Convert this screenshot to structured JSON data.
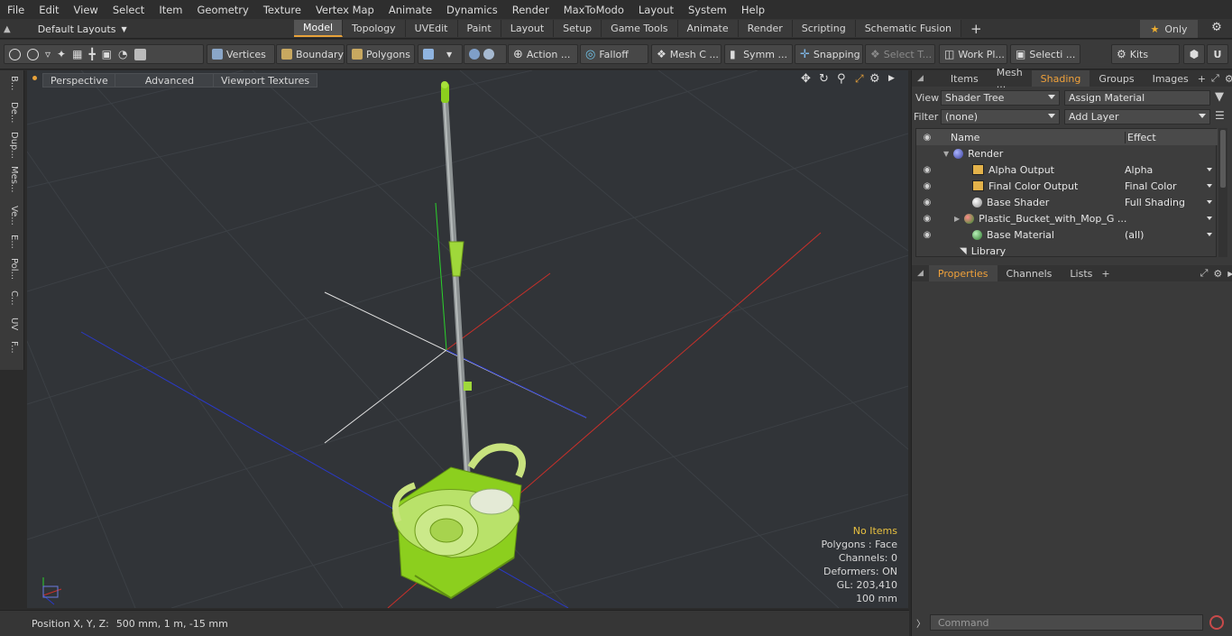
{
  "menu": [
    "File",
    "Edit",
    "View",
    "Select",
    "Item",
    "Geometry",
    "Texture",
    "Vertex Map",
    "Animate",
    "Dynamics",
    "Render",
    "MaxToModo",
    "Layout",
    "System",
    "Help"
  ],
  "layout_selector": "Default Layouts",
  "tabs": [
    "Model",
    "Topology",
    "UVEdit",
    "Paint",
    "Layout",
    "Setup",
    "Game Tools",
    "Animate",
    "Render",
    "Scripting",
    "Schematic Fusion"
  ],
  "active_tab": "Model",
  "only_label": "Only",
  "toolbar": {
    "vertices": "Vertices",
    "boundary": "Boundary",
    "polygons": "Polygons",
    "action": "Action ...",
    "falloff": "Falloff",
    "mesh": "Mesh C ...",
    "symm": "Symm ...",
    "snapping": "Snapping",
    "select_t": "Select T...",
    "workplane": "Work Pl...",
    "selecti": "Selecti ...",
    "kits": "Kits"
  },
  "left_tabs": [
    "B...",
    "De...",
    "Dup...",
    "Mes...",
    "Ve...",
    "E...",
    "Pol...",
    "C...",
    "UV",
    "F..."
  ],
  "viewport": {
    "perspective": "Perspective",
    "advanced": "Advanced",
    "viewport_textures": "Viewport Textures",
    "stats": {
      "items": "No Items",
      "polygons": "Polygons : Face",
      "channels": "Channels: 0",
      "deformers": "Deformers: ON",
      "gl": "GL: 203,410",
      "scale": "100 mm"
    }
  },
  "status": {
    "label": "Position X, Y, Z:",
    "value": "500 mm, 1 m, -15 mm"
  },
  "right_panel": {
    "tabs": [
      "Items",
      "Mesh ...",
      "Shading",
      "Groups",
      "Images"
    ],
    "active_tab": "Shading",
    "view_label": "View",
    "view_value": "Shader Tree",
    "assign_material": "Assign Material",
    "filter_label": "Filter",
    "filter_value": "(none)",
    "add_layer": "Add Layer",
    "columns": {
      "name": "Name",
      "effect": "Effect"
    },
    "rows": [
      {
        "name": "Render",
        "effect": ""
      },
      {
        "name": "Alpha Output",
        "effect": "Alpha"
      },
      {
        "name": "Final Color Output",
        "effect": "Final Color"
      },
      {
        "name": "Base Shader",
        "effect": "Full Shading"
      },
      {
        "name": "Plastic_Bucket_with_Mop_G ...",
        "effect": ""
      },
      {
        "name": "Base Material",
        "effect": "(all)"
      },
      {
        "name": "Library",
        "effect": ""
      }
    ],
    "bottom_tabs": [
      "Properties",
      "Channels",
      "Lists"
    ],
    "bottom_active": "Properties",
    "command_placeholder": "Command"
  },
  "colors": {
    "accent": "#e8a23a",
    "mop_green": "#8ccf1e",
    "axis_red": "#c8302a",
    "axis_blue": "#2a39c8",
    "axis_green": "#2bd12b"
  }
}
